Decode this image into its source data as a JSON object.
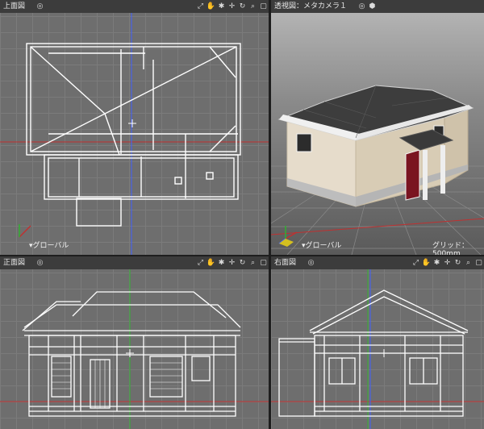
{
  "views": {
    "top": {
      "title": "上面図",
      "coord_label": "▾グローバル"
    },
    "perspective": {
      "title": "透視図：メタカメラ１",
      "coord_label": "▾グローバル",
      "grid_label": "グリッド：500mm"
    },
    "front": {
      "title": "正面図"
    },
    "right": {
      "title": "右面図"
    }
  },
  "header_icons": [
    "camera-icon",
    "lock-icon",
    "settings-icon",
    "move-icon",
    "rotate-icon",
    "zoom-icon",
    "close-icon"
  ],
  "colors": {
    "viewport_bg": "#6e6e6e",
    "header_bg": "#3c3c3c",
    "wire": "#ffffff",
    "axis_red": "#c03030",
    "axis_green": "#30b030",
    "axis_blue": "#4060ff"
  }
}
